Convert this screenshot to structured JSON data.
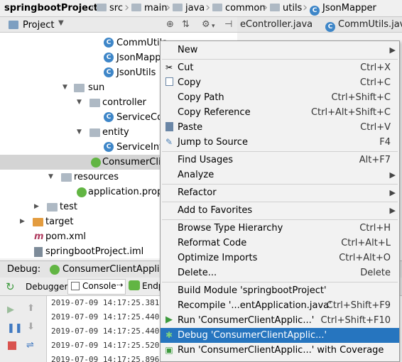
{
  "breadcrumb": {
    "items": [
      "springbootProject",
      "src",
      "main",
      "java",
      "common",
      "utils",
      "JsonMapper"
    ]
  },
  "project_panel": {
    "title": "Project",
    "icons": [
      "target-icon",
      "collapse-icon",
      "gear-icon",
      "hide-icon"
    ]
  },
  "editor_tabs": [
    "eController.java",
    "CommUtils.java"
  ],
  "tree": [
    {
      "label": "CommUtils",
      "type": "class"
    },
    {
      "label": "JsonMapp",
      "type": "class"
    },
    {
      "label": "JsonUtils",
      "type": "class"
    },
    {
      "label": "sun",
      "type": "package"
    },
    {
      "label": "controller",
      "type": "package"
    },
    {
      "label": "ServiceCon",
      "type": "class"
    },
    {
      "label": "entity",
      "type": "package"
    },
    {
      "label": "ServiceInfo",
      "type": "class"
    },
    {
      "label": "ConsumerClie",
      "type": "springboot-class",
      "selected": true
    },
    {
      "label": "resources",
      "type": "resources"
    },
    {
      "label": "application.prope",
      "type": "properties"
    },
    {
      "label": "test",
      "type": "folder"
    },
    {
      "label": "target",
      "type": "target-folder"
    },
    {
      "label": "pom.xml",
      "type": "maven"
    },
    {
      "label": "springbootProject.iml",
      "type": "iml"
    }
  ],
  "debug": {
    "label": "Debug:",
    "config": "ConsumerClientApplicat",
    "tabs": [
      "Debugger",
      "Console",
      "Endp"
    ],
    "log": [
      "2019-07-09 14:17:25.381",
      "2019-07-09 14:17:25.440",
      "2019-07-09 14:17:25.440",
      "2019-07-09 14:17:25.520",
      "2019-07-09 14:17:25.896"
    ]
  },
  "context_menu": [
    {
      "label": "New",
      "submenu": true
    },
    {
      "separator": true
    },
    {
      "label": "Cut",
      "shortcut": "Ctrl+X",
      "icon": "cut-icon"
    },
    {
      "label": "Copy",
      "shortcut": "Ctrl+C",
      "icon": "copy-icon"
    },
    {
      "label": "Copy Path",
      "shortcut": "Ctrl+Shift+C"
    },
    {
      "label": "Copy Reference",
      "shortcut": "Ctrl+Alt+Shift+C"
    },
    {
      "label": "Paste",
      "shortcut": "Ctrl+V",
      "icon": "paste-icon"
    },
    {
      "label": "Jump to Source",
      "shortcut": "F4",
      "icon": "jump-icon"
    },
    {
      "separator": true
    },
    {
      "label": "Find Usages",
      "shortcut": "Alt+F7"
    },
    {
      "label": "Analyze",
      "submenu": true
    },
    {
      "separator": true
    },
    {
      "label": "Refactor",
      "submenu": true
    },
    {
      "separator": true
    },
    {
      "label": "Add to Favorites",
      "submenu": true
    },
    {
      "separator": true
    },
    {
      "label": "Browse Type Hierarchy",
      "shortcut": "Ctrl+H"
    },
    {
      "label": "Reformat Code",
      "shortcut": "Ctrl+Alt+L"
    },
    {
      "label": "Optimize Imports",
      "shortcut": "Ctrl+Alt+O"
    },
    {
      "label": "Delete...",
      "shortcut": "Delete"
    },
    {
      "separator": true
    },
    {
      "label": "Build Module 'springbootProject'"
    },
    {
      "label": "Recompile '...entApplication.java'",
      "shortcut": "Ctrl+Shift+F9"
    },
    {
      "label": "Run 'ConsumerClientApplic...'",
      "shortcut": "Ctrl+Shift+F10",
      "icon": "run-icon"
    },
    {
      "label": "Debug 'ConsumerClientApplic...'",
      "icon": "debug-icon",
      "highlighted": true
    },
    {
      "label": "Run 'ConsumerClientApplic...' with Coverage",
      "icon": "coverage-icon"
    }
  ],
  "colors": {
    "highlight": "#2675bf",
    "selection": "#d4d4d4",
    "class_icon": "#3e86c8",
    "spring_icon": "#62b543"
  }
}
